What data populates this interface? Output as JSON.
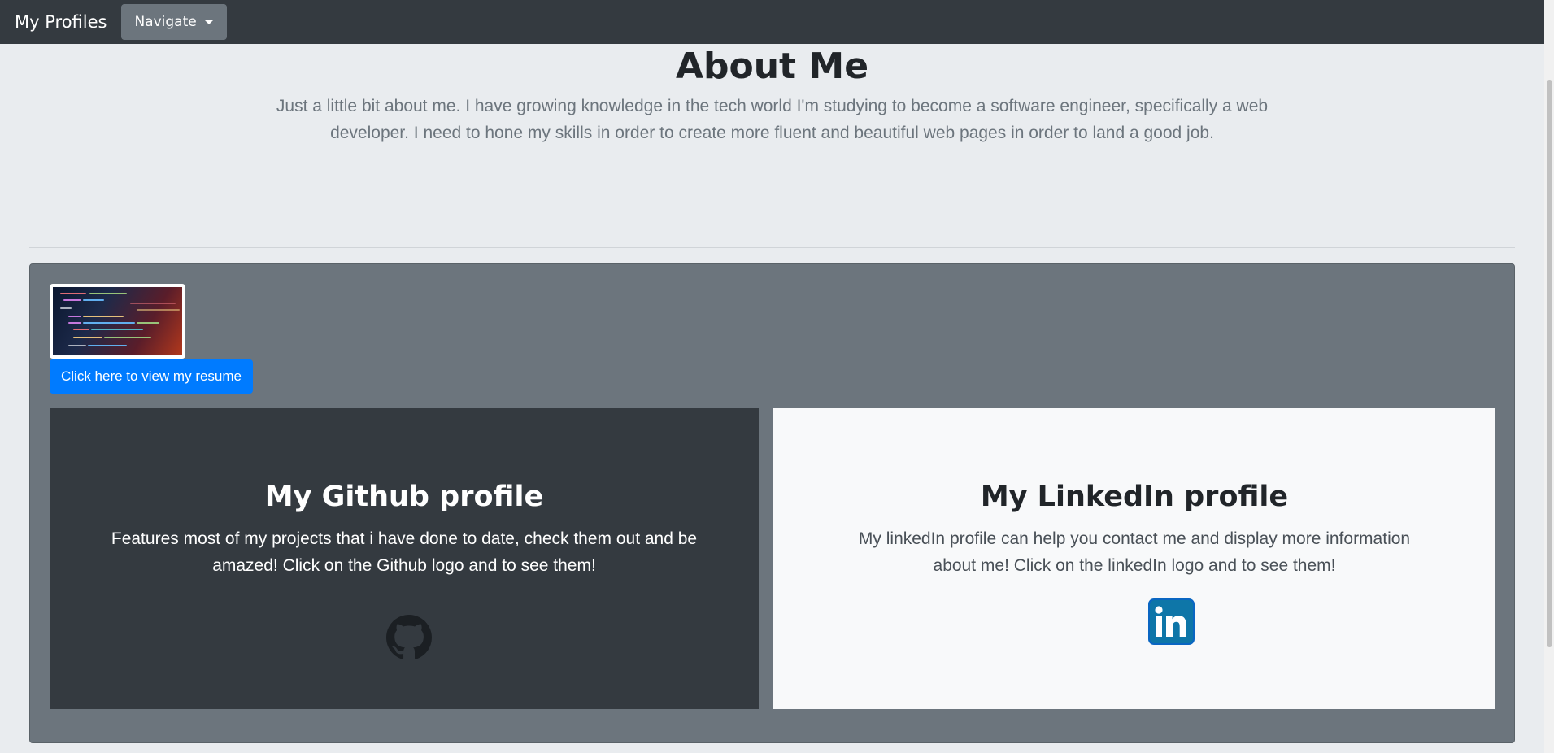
{
  "navbar": {
    "brand": "My Profiles",
    "navigate_label": "Navigate"
  },
  "hero": {
    "title": "About Me",
    "lead": "Just a little bit about me. I have growing knowledge in the tech world I'm studying to become a software engineer, specifically a web developer. I need to hone my skills in order to create more fluent and beautiful web pages in order to land a good job."
  },
  "resume": {
    "button_label": "Click here to view my resume",
    "thumbnail_icon": "code-screenshot-thumbnail"
  },
  "github_card": {
    "title": "My Github profile",
    "text": "Features most of my projects that i have done to date, check them out and be amazed! Click on the Github logo and to see them!",
    "icon": "github-icon"
  },
  "linkedin_card": {
    "title": "My LinkedIn profile",
    "text": "My linkedIn profile can help you contact me and display more information about me! Click on the linkedIn logo and to see them!",
    "icon": "linkedin-icon"
  },
  "colors": {
    "navbar": "#343a40",
    "page_bg": "#e9ecef",
    "panel": "#6c757d",
    "primary": "#007bff",
    "dark_card": "#343a40",
    "light_card": "#f8f9fa",
    "linkedin_blue": "#0a66c2"
  }
}
